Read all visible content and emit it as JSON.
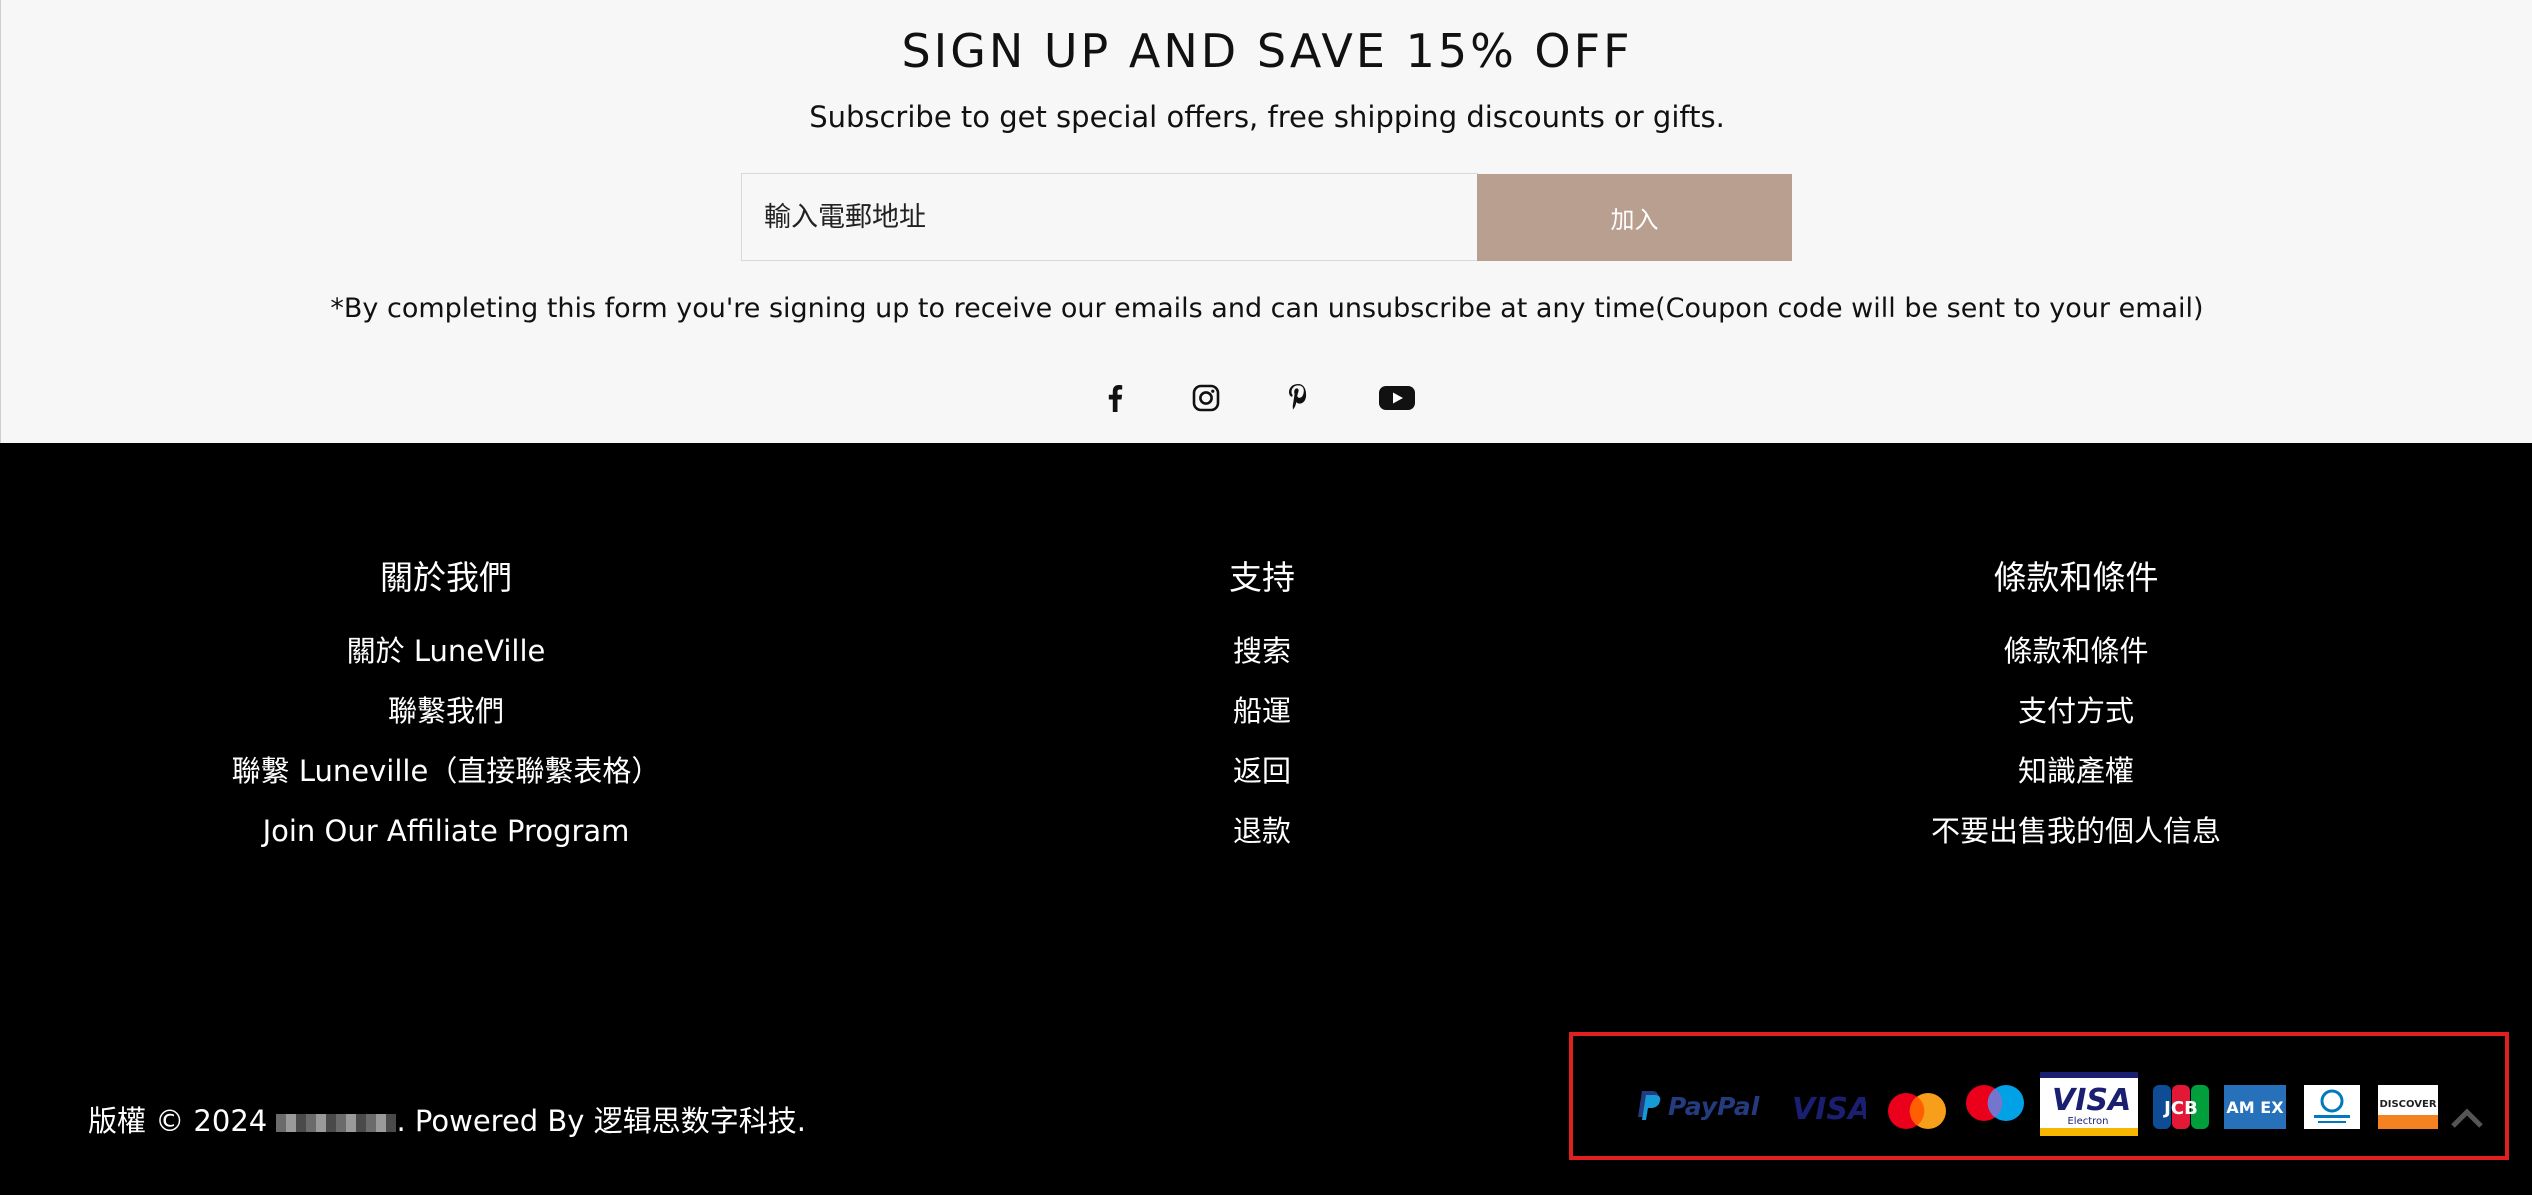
{
  "signup": {
    "title": "SIGN UP AND SAVE 15% OFF",
    "subtitle": "Subscribe to get special offers, free shipping discounts or gifts.",
    "email_placeholder": "輸入電郵地址",
    "join_label": "加入",
    "disclaimer": "*By completing this form you're signing up to receive our emails and can unsubscribe at any time(Coupon code will be sent to your email)"
  },
  "social": [
    "facebook-icon",
    "instagram-icon",
    "pinterest-icon",
    "youtube-icon"
  ],
  "footer": {
    "columns": [
      {
        "title": "關於我們",
        "links": [
          "關於 LuneVille",
          "聯繫我們",
          "聯繫 Luneville（直接聯繫表格）",
          "Join Our Affiliate Program"
        ]
      },
      {
        "title": "支持",
        "links": [
          "搜索",
          "船運",
          "返回",
          "退款"
        ]
      },
      {
        "title": "條款和條件",
        "links": [
          "條款和條件",
          "支付方式",
          "知識產權",
          "不要出售我的個人信息"
        ]
      }
    ],
    "copyright_prefix": "版權 © 2024",
    "copyright_suffix": ". Powered By 逻辑思数字科技."
  },
  "payments": [
    {
      "name": "paypal-icon",
      "label": "PayPal"
    },
    {
      "name": "visa-icon",
      "label": "VISA"
    },
    {
      "name": "mastercard-icon"
    },
    {
      "name": "maestro-icon"
    },
    {
      "name": "visa-electron-icon",
      "label": "VISA",
      "sub": "Electron"
    },
    {
      "name": "jcb-icon",
      "label": "JCB"
    },
    {
      "name": "amex-icon",
      "label": "AM EX"
    },
    {
      "name": "diners-club-icon"
    },
    {
      "name": "discover-icon",
      "label": "DISCOVER"
    }
  ],
  "colors": {
    "accent": "#b99f90",
    "highlight_box": "#e0201e"
  }
}
